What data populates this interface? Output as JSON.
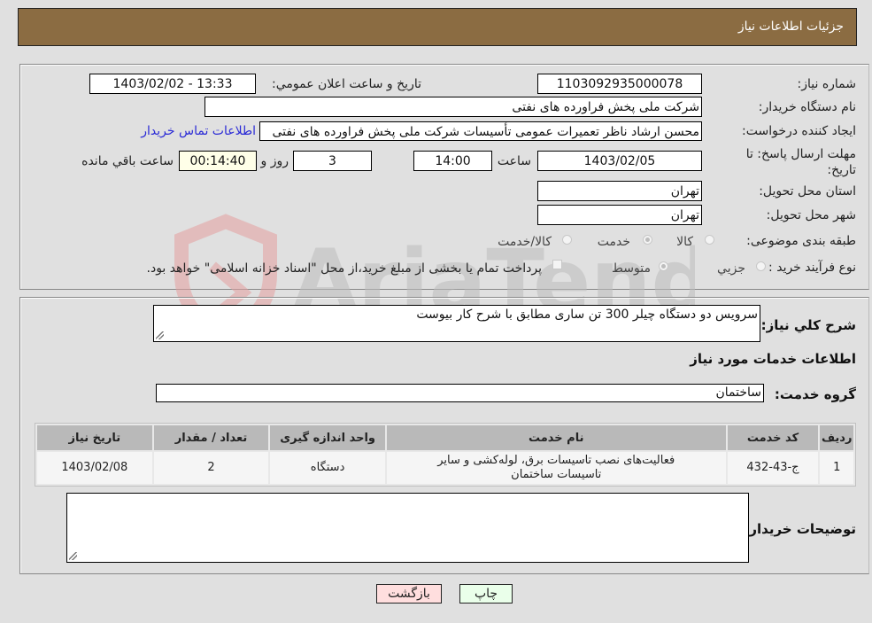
{
  "header": {
    "title": "جزئیات اطلاعات نیاز"
  },
  "fields": {
    "need_number": {
      "label": "شماره نیاز:",
      "value": "1103092935000078"
    },
    "announce_datetime": {
      "label": "تاريخ و ساعت اعلان عمومي:",
      "value": "1403/02/02 - 13:33"
    },
    "buyer_org": {
      "label": "نام دستگاه خريدار:",
      "value": "شرکت ملی پخش فراورده های نفتی"
    },
    "requester": {
      "label": "ايجاد کننده درخواست:",
      "value": "محسن ارشاد ناظر تعمیرات عمومی تأسیسات شرکت ملی پخش فراورده های نفتی"
    },
    "buyer_contact_link": "اطلاعات تماس خريدار",
    "deadline": {
      "label": "مهلت ارسال پاسخ: تا تاریخ:",
      "date": "1403/02/05",
      "time_label": "ساعت",
      "time": "14:00",
      "days": "3",
      "days_label": "روز و",
      "remaining": "00:14:40",
      "remaining_label": "ساعت باقي مانده"
    },
    "province": {
      "label": "استان محل تحويل:",
      "value": "تهران"
    },
    "city": {
      "label": "شهر محل تحويل:",
      "value": "تهران"
    },
    "category": {
      "label": "طبقه بندی موضوعی:",
      "options": [
        "کالا",
        "خدمت",
        "کالا/خدمت"
      ],
      "selected": "خدمت"
    },
    "purchase_type": {
      "label": "نوع فرآيند خريد :",
      "options": [
        "جزيي",
        "متوسط"
      ],
      "selected": "متوسط",
      "treasury_checkbox_label": "پرداخت تمام یا بخشی از مبلغ خرید،از محل \"اسناد خزانه اسلامی\" خواهد بود.",
      "treasury_checked": false
    }
  },
  "description": {
    "label": "شرح کلي نياز:",
    "value": "سرویس دو دستگاه چیلر 300 تن ساری مطابق با شرح کار بیوست"
  },
  "services_section": {
    "title": "اطلاعات خدمات مورد نياز",
    "group_label": "گروه خدمت:",
    "group_value": "ساختمان"
  },
  "table": {
    "headers": [
      "رديف",
      "کد خدمت",
      "نام خدمت",
      "واحد اندازه گيری",
      "تعداد / مقدار",
      "تاريخ نياز"
    ],
    "rows": [
      [
        "1",
        "ج-43-432",
        "فعالیت‌های نصب تاسیسات برق، لوله‌کشی و سایر تاسیسات ساختمان",
        "دستگاه",
        "2",
        "1403/02/08"
      ]
    ]
  },
  "buyer_notes": {
    "label": "توضيحات خريدار:",
    "value": ""
  },
  "buttons": {
    "print": "چاپ",
    "back": "بازگشت"
  },
  "watermark": {
    "text": "AriaTender.neT"
  },
  "colors": {
    "header": "#8b6c42",
    "link": "#2a2ad6",
    "back_button": "#ffdede",
    "print_button": "#eaffea",
    "remaining_box": "#ffffe8"
  }
}
